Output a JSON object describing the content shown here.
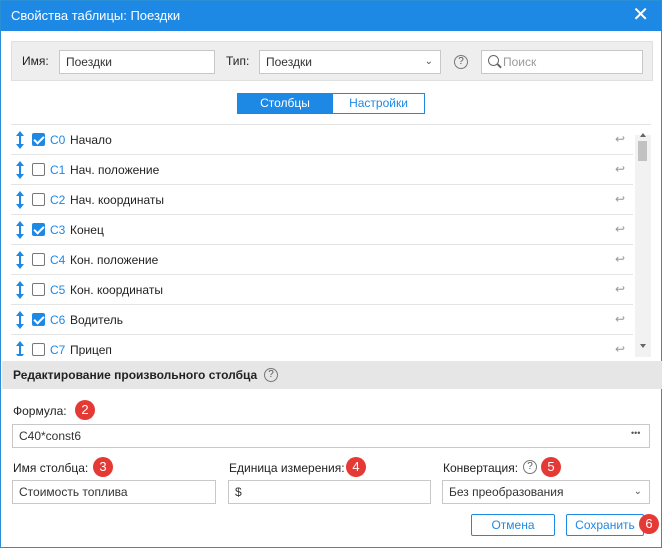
{
  "window": {
    "title": "Свойства таблицы: Поездки",
    "close_glyph": "✕"
  },
  "toolbar": {
    "name_label": "Имя:",
    "name_value": "Поездки",
    "type_label": "Тип:",
    "type_value": "Поездки",
    "help_glyph": "?",
    "search_placeholder": "Поиск"
  },
  "tabs": [
    {
      "label": "Столбцы",
      "active": true
    },
    {
      "label": "Настройки",
      "active": false
    }
  ],
  "columns": [
    {
      "code": "C0",
      "name": "Начало",
      "checked": true
    },
    {
      "code": "C1",
      "name": "Нач. положение",
      "checked": false
    },
    {
      "code": "C2",
      "name": "Нач. координаты",
      "checked": false
    },
    {
      "code": "C3",
      "name": "Конец",
      "checked": true
    },
    {
      "code": "C4",
      "name": "Кон. положение",
      "checked": false
    },
    {
      "code": "C5",
      "name": "Кон. координаты",
      "checked": false
    },
    {
      "code": "C6",
      "name": "Водитель",
      "checked": true
    },
    {
      "code": "C7",
      "name": "Прицеп",
      "checked": false
    }
  ],
  "editor": {
    "section_title": "Редактирование произвольного столбца",
    "formula_label": "Формула:",
    "formula_value": "C40*const6",
    "formula_menu": "•••",
    "colname_label": "Имя столбца:",
    "colname_value": "Стоимость топлива",
    "unit_label": "Единица измерения:",
    "unit_value": "$",
    "conversion_label": "Конвертация:",
    "conversion_value": "Без преобразования"
  },
  "badges": {
    "b2": "2",
    "b3": "3",
    "b4": "4",
    "b5": "5",
    "b6": "6"
  },
  "buttons": {
    "cancel": "Отмена",
    "save": "Сохранить"
  },
  "colors": {
    "accent": "#1e88e5",
    "badge": "#e53935"
  }
}
